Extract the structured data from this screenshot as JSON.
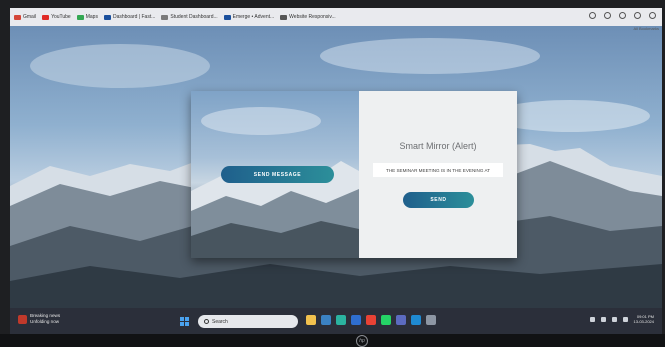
{
  "bookmarks": [
    {
      "label": "Gmail",
      "color": "#d44638"
    },
    {
      "label": "YouTube",
      "color": "#e02b27"
    },
    {
      "label": "Maps",
      "color": "#34a853"
    },
    {
      "label": "Dashboard | Fast...",
      "color": "#1a4f9c"
    },
    {
      "label": "Student Dashboard...",
      "color": "#7a7a7a"
    },
    {
      "label": "Emerge • Advent...",
      "color": "#1a4f9c"
    },
    {
      "label": "Website Responsiv...",
      "color": "#555555"
    }
  ],
  "browser_profile_label": "All Bookmarks",
  "app": {
    "send_message_label": "SEND MESSAGE",
    "title": "Smart Mirror (Alert)",
    "message_value": "THE SEMINAR MEETING IS IN THE EVENING AT",
    "send_label": "SEND",
    "accent_gradient": [
      "#1f5f8c",
      "#2c8f9a"
    ]
  },
  "taskbar": {
    "news_title": "Breaking news",
    "news_subtitle": "Unfolding now",
    "search_placeholder": "Search",
    "apps": [
      "file-explorer-icon",
      "store-icon",
      "edge-icon",
      "mail-icon",
      "chrome-icon",
      "whatsapp-icon",
      "camera-icon",
      "vscode-icon",
      "settings-icon"
    ],
    "clock_time": "09:01 PM",
    "clock_date": "13-03-2024"
  },
  "monitor_brand": "hp"
}
